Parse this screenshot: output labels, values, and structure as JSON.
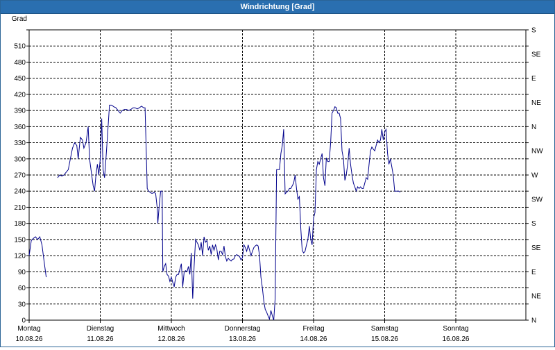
{
  "window": {
    "title": "Windrichtung [Grad]"
  },
  "chart_data": {
    "type": "line",
    "title": "Windrichtung [Grad]",
    "ylabel": "Grad",
    "ylim": [
      0,
      540
    ],
    "yticks": [
      0,
      30,
      60,
      90,
      120,
      150,
      180,
      210,
      240,
      270,
      300,
      330,
      360,
      390,
      420,
      450,
      480,
      510
    ],
    "right_labels": [
      "N",
      "NE",
      "E",
      "SE",
      "S",
      "SW",
      "W",
      "NW",
      "N",
      "NE",
      "E",
      "SE",
      "S"
    ],
    "xlim": [
      0,
      7
    ],
    "x_ticks": [
      {
        "day": "Montag",
        "date": "10.08.26"
      },
      {
        "day": "Dienstag",
        "date": "11.08.26"
      },
      {
        "day": "Mittwoch",
        "date": "12.08.26"
      },
      {
        "day": "Donnerstag",
        "date": "13.08.26"
      },
      {
        "day": "Freitag",
        "date": "14.08.26"
      },
      {
        "day": "Samstag",
        "date": "15.08.26"
      },
      {
        "day": "Sonntag",
        "date": "16.08.26"
      }
    ],
    "grid": true,
    "line_color": "#00008b",
    "series": [
      {
        "segments": [
          [
            [
              0.0,
              120
            ],
            [
              0.03,
              148
            ],
            [
              0.06,
              152
            ],
            [
              0.09,
              155
            ],
            [
              0.12,
              150
            ],
            [
              0.15,
              155
            ],
            [
              0.18,
              140
            ],
            [
              0.21,
              110
            ],
            [
              0.24,
              80
            ]
          ],
          [
            [
              0.4,
              265
            ],
            [
              0.43,
              270
            ],
            [
              0.46,
              268
            ],
            [
              0.49,
              270
            ],
            [
              0.52,
              275
            ],
            [
              0.55,
              280
            ],
            [
              0.58,
              300
            ],
            [
              0.61,
              320
            ],
            [
              0.64,
              330
            ],
            [
              0.67,
              325
            ],
            [
              0.69,
              300
            ],
            [
              0.72,
              340
            ],
            [
              0.75,
              335
            ],
            [
              0.77,
              320
            ],
            [
              0.8,
              330
            ],
            [
              0.83,
              360
            ],
            [
              0.85,
              300
            ],
            [
              0.88,
              270
            ],
            [
              0.9,
              250
            ],
            [
              0.92,
              240
            ],
            [
              0.94,
              270
            ],
            [
              0.96,
              290
            ],
            [
              0.98,
              270
            ],
            [
              1.0,
              300
            ],
            [
              1.02,
              375
            ],
            [
              1.04,
              280
            ],
            [
              1.06,
              265
            ],
            [
              1.08,
              300
            ],
            [
              1.1,
              340
            ],
            [
              1.13,
              400
            ],
            [
              1.16,
              400
            ],
            [
              1.19,
              397
            ],
            [
              1.22,
              395
            ],
            [
              1.25,
              390
            ],
            [
              1.28,
              385
            ],
            [
              1.31,
              390
            ],
            [
              1.34,
              392
            ],
            [
              1.37,
              392
            ],
            [
              1.4,
              390
            ],
            [
              1.43,
              392
            ],
            [
              1.46,
              395
            ],
            [
              1.49,
              395
            ],
            [
              1.52,
              393
            ],
            [
              1.55,
              395
            ],
            [
              1.58,
              398
            ],
            [
              1.61,
              395
            ],
            [
              1.63,
              395
            ],
            [
              1.65,
              300
            ],
            [
              1.66,
              245
            ],
            [
              1.68,
              240
            ],
            [
              1.7,
              238
            ],
            [
              1.72,
              236
            ],
            [
              1.74,
              236
            ],
            [
              1.76,
              238
            ],
            [
              1.78,
              235
            ],
            [
              1.8,
              210
            ],
            [
              1.81,
              180
            ],
            [
              1.83,
              215
            ],
            [
              1.85,
              240
            ],
            [
              1.87,
              240
            ],
            [
              1.88,
              90
            ],
            [
              1.9,
              100
            ],
            [
              1.92,
              105
            ],
            [
              1.94,
              85
            ],
            [
              1.96,
              82
            ],
            [
              1.98,
              72
            ],
            [
              2.0,
              80
            ],
            [
              2.02,
              70
            ],
            [
              2.04,
              62
            ],
            [
              2.06,
              80
            ],
            [
              2.08,
              85
            ],
            [
              2.1,
              85
            ],
            [
              2.12,
              95
            ],
            [
              2.14,
              105
            ],
            [
              2.16,
              62
            ],
            [
              2.18,
              90
            ],
            [
              2.2,
              92
            ],
            [
              2.22,
              90
            ],
            [
              2.24,
              100
            ],
            [
              2.26,
              85
            ],
            [
              2.28,
              125
            ],
            [
              2.3,
              40
            ],
            [
              2.32,
              100
            ],
            [
              2.34,
              150
            ],
            [
              2.36,
              145
            ],
            [
              2.38,
              140
            ],
            [
              2.4,
              130
            ],
            [
              2.42,
              145
            ],
            [
              2.44,
              120
            ],
            [
              2.46,
              155
            ],
            [
              2.48,
              145
            ],
            [
              2.5,
              148
            ],
            [
              2.52,
              130
            ],
            [
              2.54,
              138
            ],
            [
              2.56,
              122
            ],
            [
              2.58,
              140
            ],
            [
              2.6,
              130
            ],
            [
              2.62,
              140
            ],
            [
              2.64,
              132
            ],
            [
              2.66,
              112
            ],
            [
              2.68,
              128
            ],
            [
              2.7,
              128
            ],
            [
              2.72,
              122
            ],
            [
              2.74,
              138
            ],
            [
              2.76,
              118
            ],
            [
              2.78,
              110
            ],
            [
              2.8,
              115
            ],
            [
              2.82,
              112
            ],
            [
              2.84,
              110
            ],
            [
              2.86,
              113
            ],
            [
              2.88,
              114
            ],
            [
              2.9,
              120
            ],
            [
              2.92,
              122
            ],
            [
              2.94,
              120
            ],
            [
              2.96,
              118
            ],
            [
              2.98,
              112
            ],
            [
              3.0,
              116
            ],
            [
              3.02,
              140
            ],
            [
              3.04,
              135
            ],
            [
              3.06,
              128
            ],
            [
              3.08,
              140
            ],
            [
              3.1,
              130
            ],
            [
              3.12,
              120
            ],
            [
              3.14,
              128
            ],
            [
              3.16,
              135
            ],
            [
              3.18,
              138
            ],
            [
              3.2,
              140
            ],
            [
              3.22,
              138
            ],
            [
              3.24,
              120
            ],
            [
              3.26,
              80
            ],
            [
              3.28,
              60
            ],
            [
              3.3,
              35
            ],
            [
              3.32,
              20
            ],
            [
              3.34,
              15
            ],
            [
              3.36,
              8
            ],
            [
              3.38,
              2
            ],
            [
              3.4,
              18
            ],
            [
              3.42,
              8
            ],
            [
              3.44,
              0
            ],
            [
              3.46,
              40
            ],
            [
              3.48,
              280
            ],
            [
              3.5,
              280
            ],
            [
              3.52,
              280
            ],
            [
              3.54,
              310
            ],
            [
              3.56,
              325
            ],
            [
              3.58,
              355
            ],
            [
              3.6,
              235
            ],
            [
              3.62,
              238
            ],
            [
              3.64,
              240
            ],
            [
              3.66,
              245
            ],
            [
              3.68,
              245
            ],
            [
              3.7,
              250
            ],
            [
              3.72,
              255
            ],
            [
              3.74,
              270
            ],
            [
              3.76,
              245
            ],
            [
              3.78,
              225
            ],
            [
              3.8,
              230
            ],
            [
              3.82,
              170
            ],
            [
              3.84,
              130
            ],
            [
              3.86,
              125
            ],
            [
              3.88,
              128
            ],
            [
              3.9,
              140
            ],
            [
              3.92,
              150
            ],
            [
              3.94,
              175
            ],
            [
              3.96,
              150
            ],
            [
              3.98,
              140
            ],
            [
              4.0,
              190
            ],
            [
              4.02,
              200
            ],
            [
              4.04,
              280
            ],
            [
              4.06,
              295
            ],
            [
              4.08,
              290
            ],
            [
              4.1,
              300
            ],
            [
              4.12,
              310
            ],
            [
              4.14,
              265
            ],
            [
              4.16,
              250
            ],
            [
              4.18,
              302
            ],
            [
              4.2,
              295
            ],
            [
              4.22,
              295
            ],
            [
              4.24,
              330
            ],
            [
              4.26,
              385
            ],
            [
              4.28,
              390
            ],
            [
              4.3,
              397
            ],
            [
              4.32,
              395
            ],
            [
              4.34,
              385
            ],
            [
              4.36,
              385
            ],
            [
              4.38,
              375
            ],
            [
              4.4,
              315
            ],
            [
              4.42,
              300
            ],
            [
              4.44,
              260
            ],
            [
              4.46,
              270
            ],
            [
              4.48,
              290
            ],
            [
              4.5,
              320
            ],
            [
              4.52,
              290
            ],
            [
              4.54,
              270
            ],
            [
              4.56,
              255
            ],
            [
              4.58,
              248
            ],
            [
              4.6,
              240
            ],
            [
              4.62,
              248
            ],
            [
              4.64,
              245
            ],
            [
              4.66,
              248
            ],
            [
              4.68,
              245
            ],
            [
              4.7,
              245
            ],
            [
              4.72,
              255
            ],
            [
              4.74,
              265
            ],
            [
              4.76,
              262
            ],
            [
              4.78,
              290
            ],
            [
              4.8,
              315
            ],
            [
              4.82,
              322
            ],
            [
              4.84,
              318
            ],
            [
              4.86,
              315
            ],
            [
              4.88,
              325
            ],
            [
              4.9,
              335
            ],
            [
              4.92,
              330
            ],
            [
              4.94,
              335
            ],
            [
              4.96,
              355
            ],
            [
              4.98,
              335
            ],
            [
              5.0,
              350
            ],
            [
              5.02,
              355
            ],
            [
              5.04,
              310
            ],
            [
              5.06,
              290
            ],
            [
              5.08,
              300
            ],
            [
              5.1,
              285
            ],
            [
              5.12,
              270
            ],
            [
              5.14,
              240
            ],
            [
              5.16,
              240
            ],
            [
              5.18,
              240
            ],
            [
              5.2,
              240
            ],
            [
              5.22,
              238
            ]
          ]
        ]
      }
    ]
  }
}
